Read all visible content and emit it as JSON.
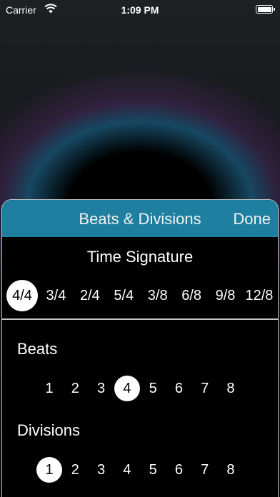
{
  "status_bar": {
    "carrier": "Carrier",
    "time": "1:09 PM"
  },
  "sheet": {
    "title": "Beats & Divisions",
    "done_label": "Done",
    "accent_color": "#1e7fa0",
    "time_signature": {
      "label": "Time Signature",
      "options": [
        "4/4",
        "3/4",
        "2/4",
        "5/4",
        "3/8",
        "6/8",
        "9/8",
        "12/8"
      ],
      "selected": "4/4"
    },
    "beats": {
      "label": "Beats",
      "options": [
        "1",
        "2",
        "3",
        "4",
        "5",
        "6",
        "7",
        "8"
      ],
      "selected": "4"
    },
    "divisions": {
      "label": "Divisions",
      "options": [
        "1",
        "2",
        "3",
        "4",
        "5",
        "6",
        "7",
        "8"
      ],
      "selected": "1"
    }
  }
}
